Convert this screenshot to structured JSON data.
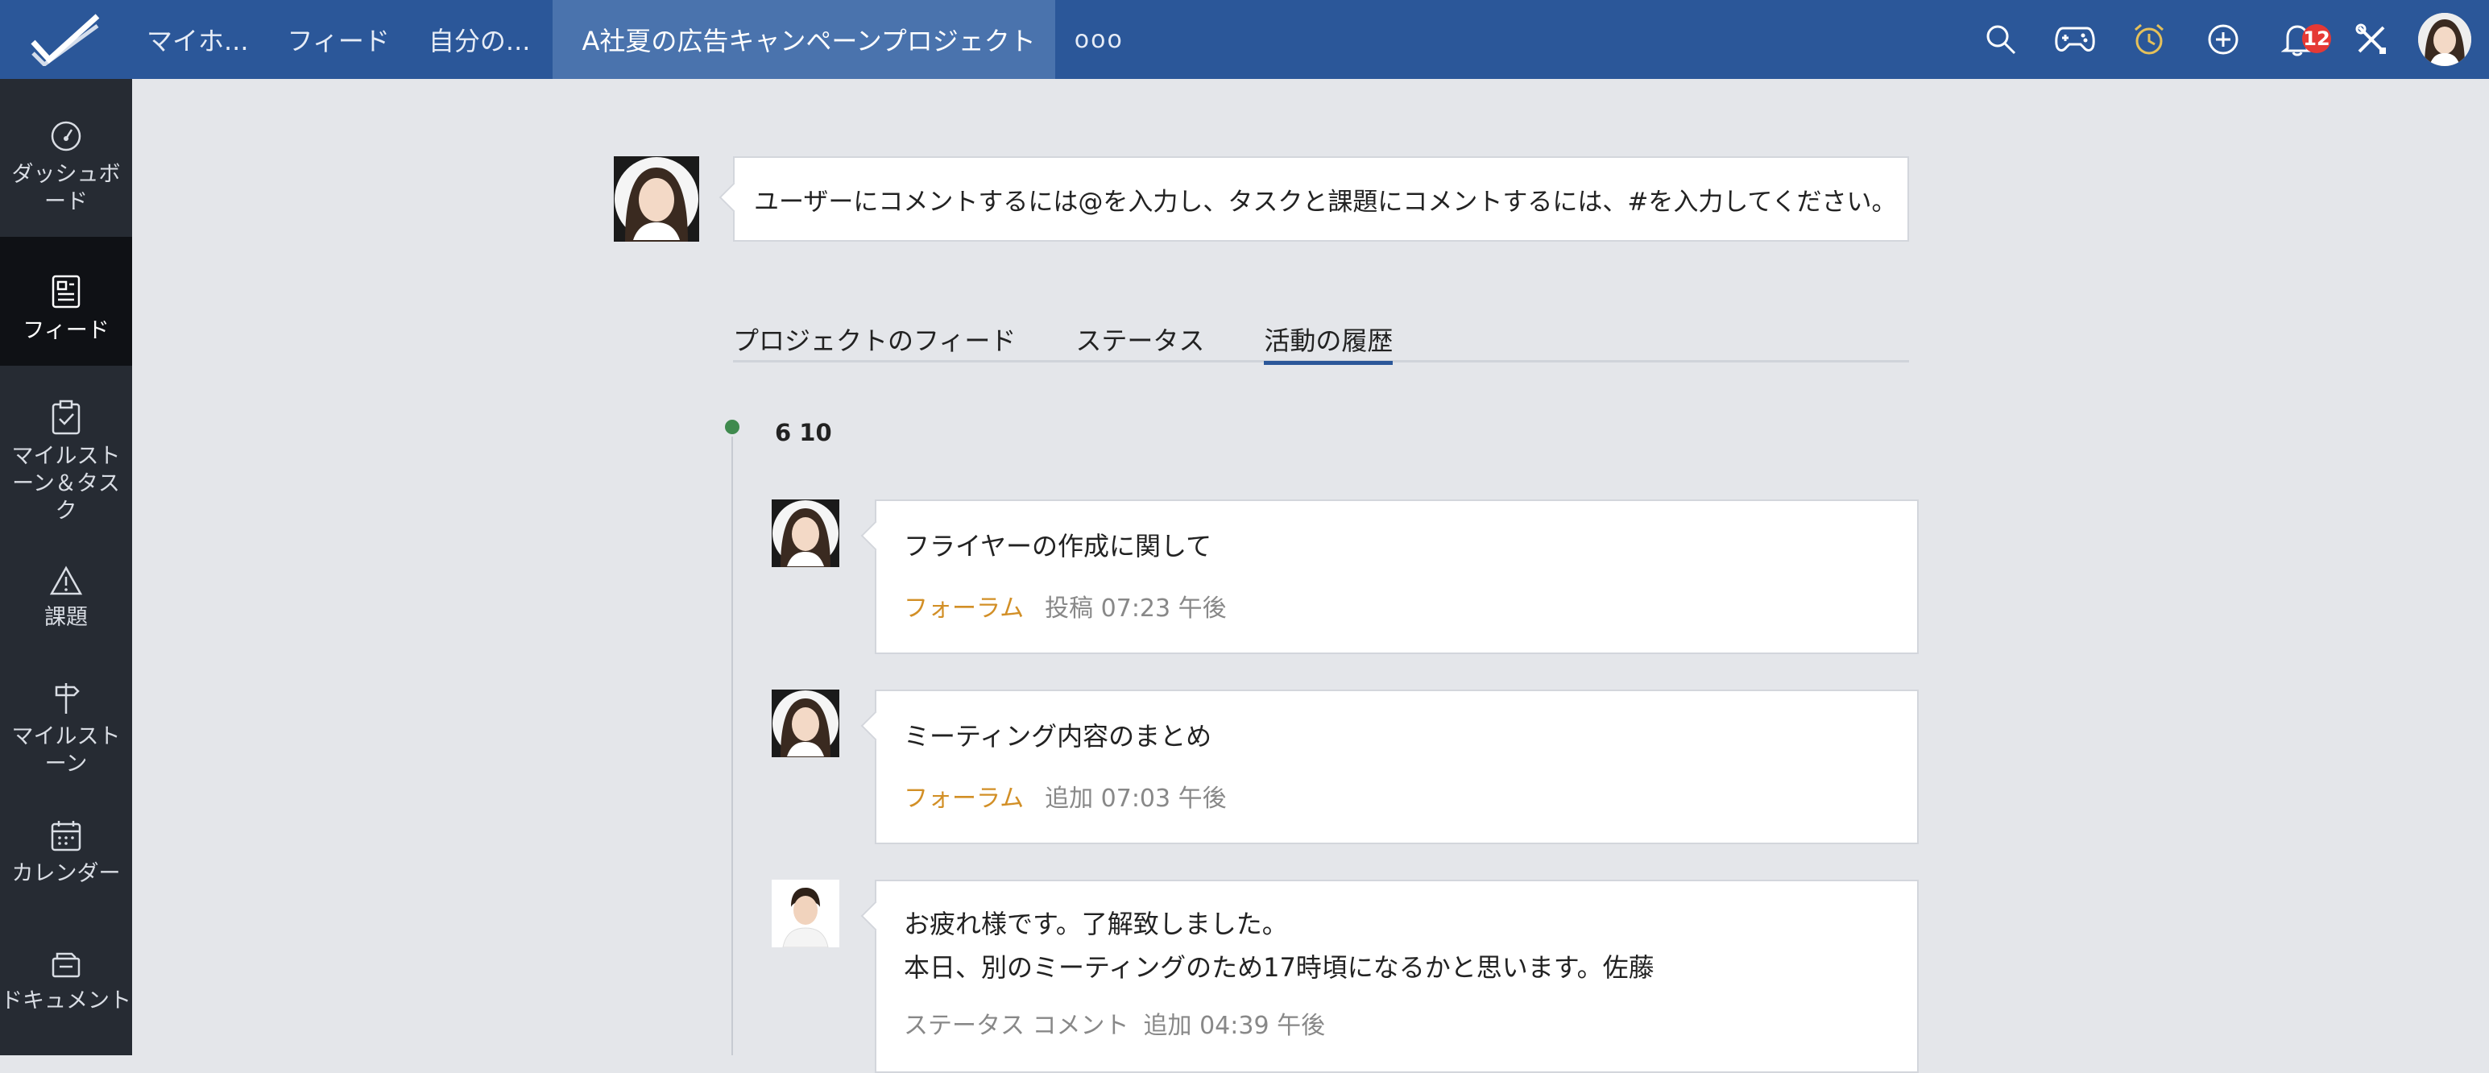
{
  "topbar": {
    "tabs": [
      "マイホ...",
      "フィード",
      "自分の..."
    ],
    "active_project": "A社夏の広告キャンペーンプロジェクト",
    "more_label": "ooo",
    "notification_count": "12",
    "icons": [
      "search-icon",
      "gamepad-icon",
      "alarm-clock-icon",
      "add-icon",
      "bell-icon",
      "tools-icon"
    ]
  },
  "sidebar": {
    "items": [
      {
        "label": "ダッシュボード",
        "icon": "speedometer-icon"
      },
      {
        "label": "フィード",
        "icon": "feed-icon"
      },
      {
        "label": "マイルストーン＆タスク",
        "icon": "clipboard-check-icon"
      },
      {
        "label": "課題",
        "icon": "warning-icon"
      },
      {
        "label": "マイルストーン",
        "icon": "signpost-icon"
      },
      {
        "label": "カレンダー",
        "icon": "calendar-icon"
      },
      {
        "label": "ドキュメント",
        "icon": "documents-icon"
      }
    ]
  },
  "composer": {
    "placeholder": "ユーザーにコメントするには@を入力し、タスクと課題にコメントするには、#を入力してください。"
  },
  "tabs": [
    "プロジェクトのフィード",
    "ステータス",
    "活動の履歴"
  ],
  "timeline": {
    "date": "6 10",
    "entries": [
      {
        "title": "フライヤーの作成に関して",
        "tag": "フォーラム",
        "meta": "投稿 07:23 午後"
      },
      {
        "title": "ミーティング内容のまとめ",
        "tag": "フォーラム",
        "meta": "追加 07:03 午後"
      },
      {
        "line1": "お疲れ様です。了解致しました。",
        "line2": "本日、別のミーティングのため17時頃になるかと思います。",
        "signature": "佐藤",
        "tag": "ステータス コメント",
        "meta": "追加 04:39 午後"
      }
    ]
  },
  "colors": {
    "topbar": "#2b5799",
    "sidebar": "#262b33",
    "accent_tag": "#d28f26",
    "timeline_dot": "#3f8a4e",
    "badge": "#e53935"
  }
}
